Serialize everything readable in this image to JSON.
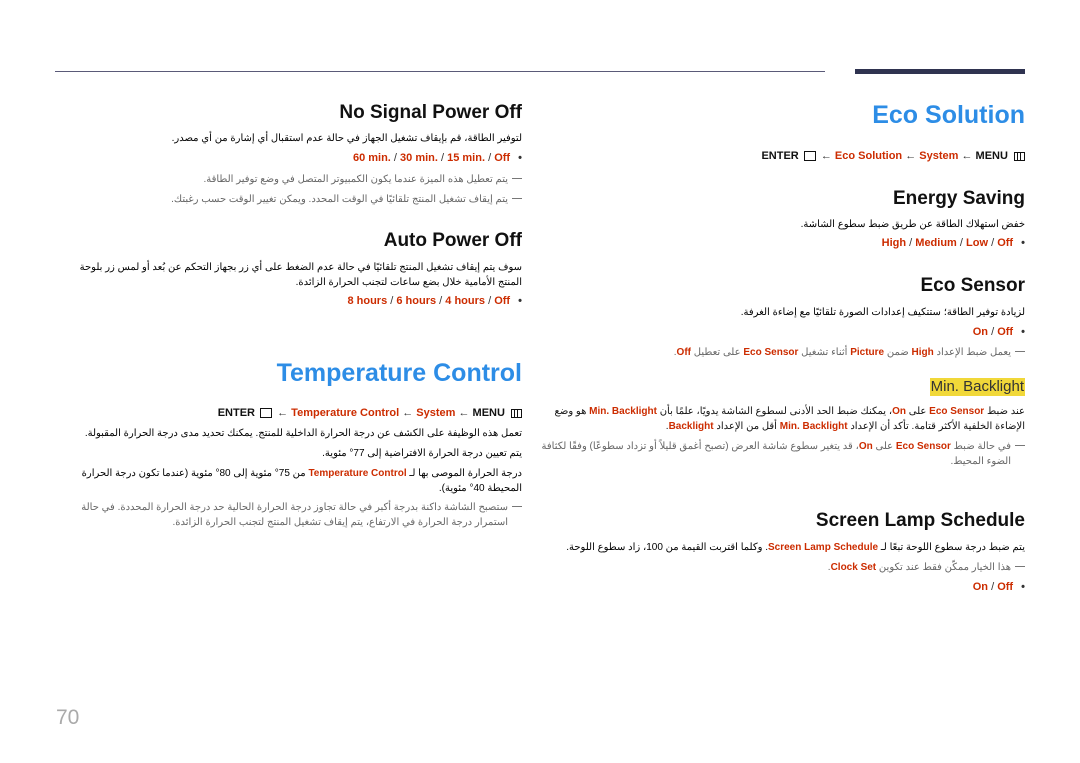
{
  "page_number": "70",
  "eco_solution": {
    "title": "Eco Solution",
    "menu_path": {
      "enter": "ENTER",
      "item": "Eco Solution",
      "system": "System",
      "menu": "MENU",
      "arrow": "←"
    },
    "energy_saving": {
      "title": "Energy Saving",
      "desc": "خفض استهلاك الطاقة عن طريق ضبط سطوع الشاشة.",
      "options": [
        "High",
        "Medium",
        "Low",
        "Off"
      ]
    },
    "eco_sensor": {
      "title": "Eco Sensor",
      "desc": "لزيادة توفير الطاقة؛ ستتكيف إعدادات الصورة تلقائيًا مع إضاءة الغرفة.",
      "options": [
        "On",
        "Off"
      ],
      "note_pre": "يعمل ضبط الإعداد ",
      "note_high": "High",
      "note_mid1": " ضمن ",
      "note_picture": "Picture",
      "note_mid2": " أثناء تشغيل ",
      "note_sensor": "Eco Sensor",
      "note_mid3": " على تعطيل ",
      "note_off": "Off",
      "note_end": "."
    },
    "min_backlight": {
      "title": "Min. Backlight",
      "p1_a": "عند ضبط ",
      "p1_sensor": "Eco Sensor",
      "p1_b": " على ",
      "p1_on": "On",
      "p1_c": "، يمكنك ضبط الحد الأدنى لسطوع الشاشة يدويًا، علمًا بأن ",
      "p1_minbl": "Min. Backlight",
      "p1_d": " هو وضع الإضاءة الخلفية الأكثر قتامة. تأكد أن الإعداد ",
      "p1_minbl2": "Min. Backlight",
      "p1_e": " أقل من الإعداد ",
      "p1_bl": "Backlight",
      "p1_f": ".",
      "note_a": "في حالة ضبط ",
      "note_sensor": "Eco Sensor",
      "note_b": " على ",
      "note_on": "On",
      "note_c": "، قد يتغير سطوع شاشة العرض (تصبح أغمق قليلاً أو تزداد سطوعًا) وفقًا لكثافة الضوء المحيط."
    },
    "screen_lamp": {
      "title": "Screen Lamp Schedule",
      "p_a": "يتم ضبط درجة سطوع اللوحة تبعًا لـ ",
      "p_name": "Screen Lamp Schedule",
      "p_b": ". وكلما اقتربت القيمة من 100، زاد سطوع اللوحة.",
      "note_a": "هذا الخيار ممكّن فقط عند تكوين ",
      "note_clock": "Clock Set",
      "note_b": ".",
      "options": [
        "On",
        "Off"
      ]
    }
  },
  "no_signal": {
    "title": "No Signal Power Off",
    "desc": "لتوفير الطاقة، قم بإيقاف تشغيل الجهاز في حالة عدم استقبال أي إشارة من أي مصدر.",
    "options": [
      "60 min.",
      "30 min.",
      "15 min.",
      "Off"
    ],
    "note1": "يتم تعطيل هذه الميزة عندما يكون الكمبيوتر المتصل في وضع توفير الطاقة.",
    "note2": "يتم إيقاف تشغيل المنتج تلقائيًا في الوقت المحدد. ويمكن تغيير الوقت حسب رغبتك."
  },
  "auto_power_off": {
    "title": "Auto Power Off",
    "desc": "سوف يتم إيقاف تشغيل المنتج تلقائيًا في حالة عدم الضغط على أي زر بجهاز التحكم عن بُعد أو لمس زر بلوحة المنتج الأمامية خلال بضع ساعات لتجنب الحرارة الزائدة.",
    "options": [
      "8 hours",
      "6 hours",
      "4 hours",
      "Off"
    ]
  },
  "temperature_control": {
    "title": "Temperature Control",
    "menu_path": {
      "enter": "ENTER",
      "item": "Temperature Control",
      "system": "System",
      "menu": "MENU",
      "arrow": "←"
    },
    "p1": "تعمل هذه الوظيفة على الكشف عن درجة الحرارة الداخلية للمنتج. يمكنك تحديد مدى درجة الحرارة المقبولة.",
    "p2": "يتم تعيين درجة الحرارة الافتراضية إلى 77° مئوية.",
    "p3_a": "درجة الحرارة الموصى بها لـ ",
    "p3_name": "Temperature Control",
    "p3_b": " من 75° مئوية إلى 80° مئوية (عندما تكون درجة الحرارة المحيطة 40° مئوية).",
    "note": "ستصبح الشاشة داكنة بدرجة أكبر في حالة تجاوز درجة الحرارة الحالية حد درجة الحرارة المحددة. في حالة استمرار درجة الحرارة في الارتفاع، يتم إيقاف تشغيل المنتج لتجنب الحرارة الزائدة."
  },
  "colors": {
    "heading_blue": "#2d8de6",
    "option_red": "#cc2c00",
    "highlight_yellow": "#f1d839"
  }
}
